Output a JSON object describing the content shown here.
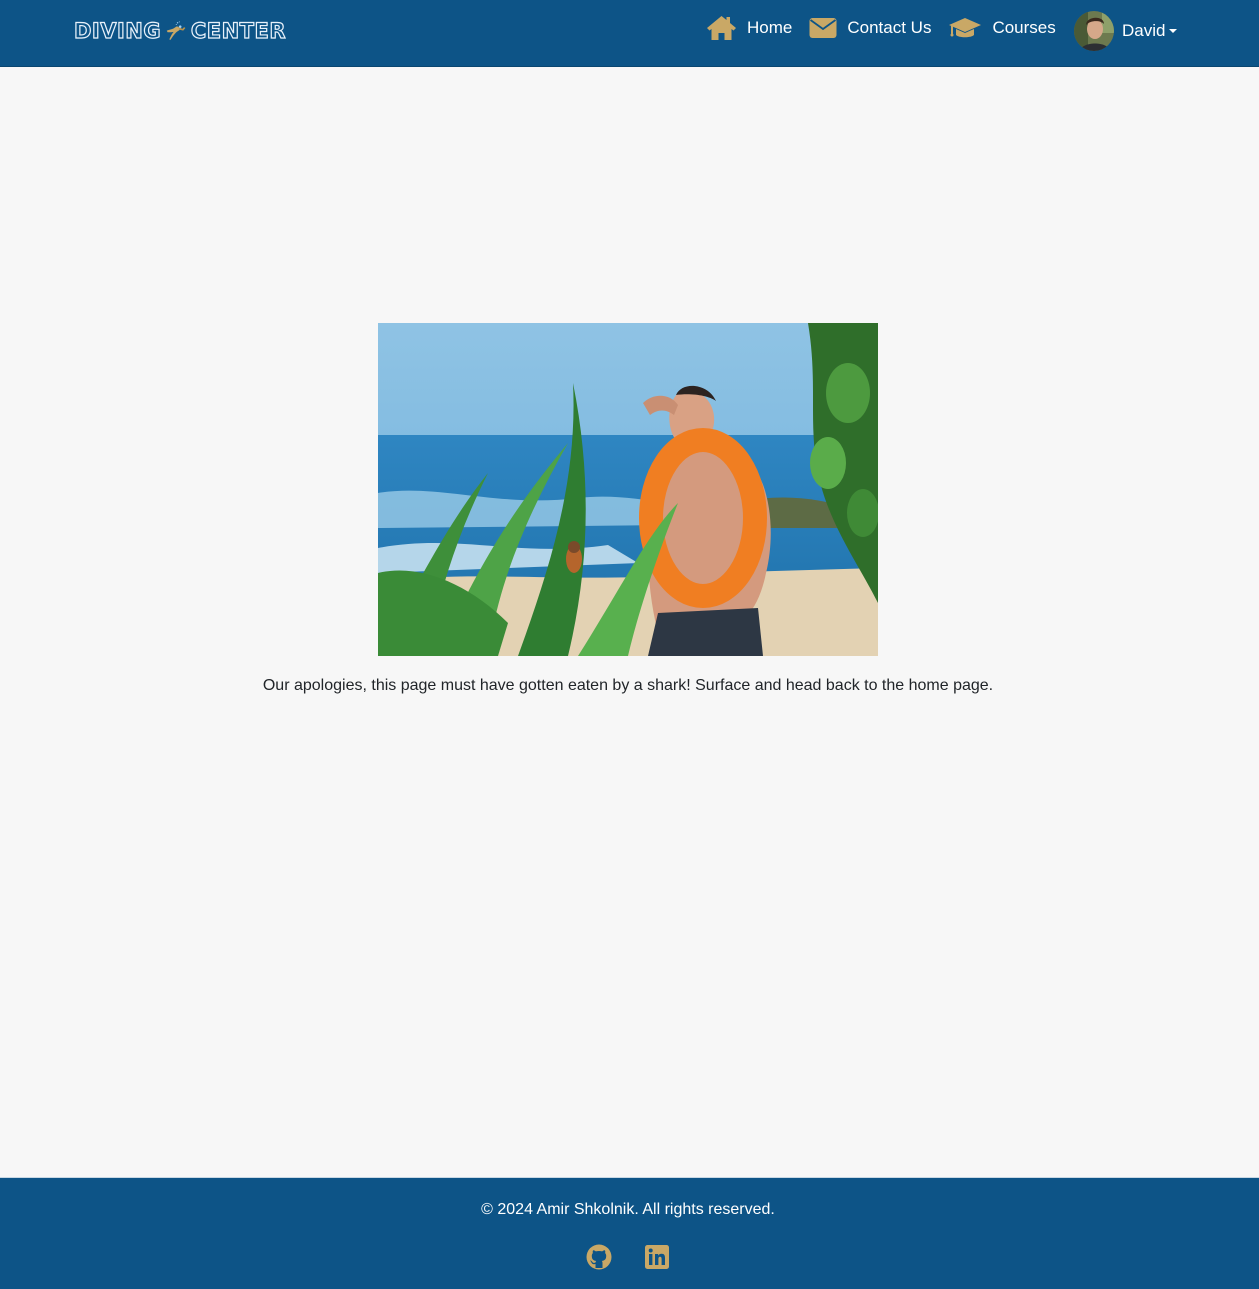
{
  "brand": {
    "logo_left": "DIVING",
    "logo_right": "CENTER",
    "accent_color": "#c9a866",
    "nav_bg": "#0d5487"
  },
  "nav": {
    "items": [
      {
        "label": "Home",
        "icon": "home-icon"
      },
      {
        "label": "Contact Us",
        "icon": "envelope-icon"
      },
      {
        "label": "Courses",
        "icon": "graduation-cap-icon"
      }
    ],
    "user": {
      "name": "David",
      "icon": "avatar"
    }
  },
  "main": {
    "message": "Our apologies, this page must have gotten eaten by a shark! Surface and head back to the home page."
  },
  "footer": {
    "copyright": "© 2024 Amir Shkolnik. All rights reserved.",
    "socials": [
      {
        "icon": "github-icon"
      },
      {
        "icon": "linkedin-icon"
      }
    ]
  }
}
